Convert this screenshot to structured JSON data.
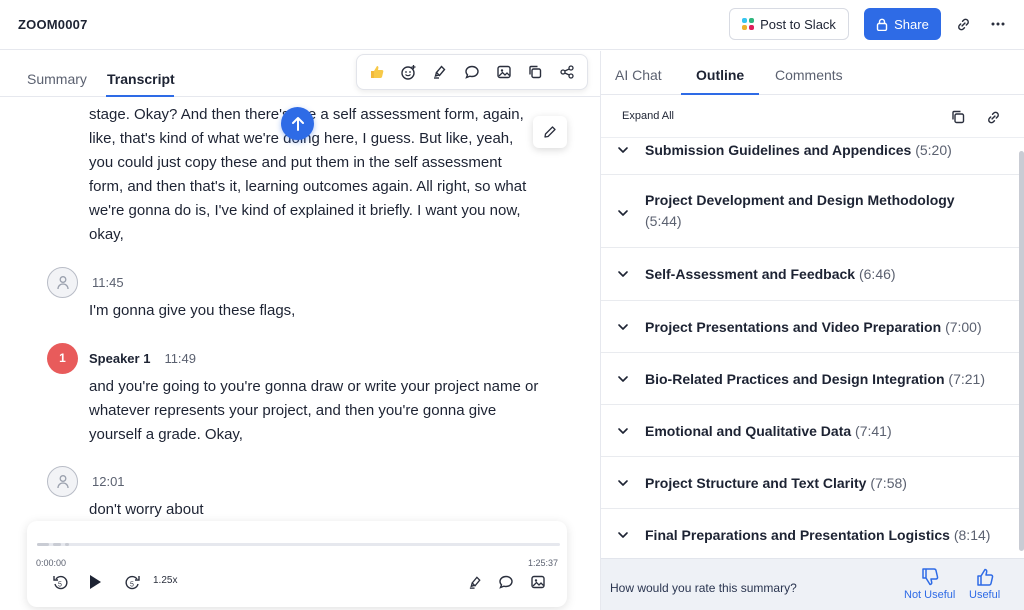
{
  "header": {
    "meeting_title": "ZOOM0007",
    "slack_button": "Post to Slack",
    "share_button": "Share",
    "colors": {
      "accent": "#2e6be6"
    }
  },
  "left_tabs": [
    {
      "label": "Summary"
    },
    {
      "label": "Transcript"
    }
  ],
  "toolbar": {
    "icons": [
      "thumbs-up-icon",
      "add-emoji-icon",
      "highlighter-icon",
      "comment-icon",
      "image-icon",
      "copy-icon",
      "share-icon"
    ]
  },
  "transcript": {
    "intro_paragraph": "stage. Okay? And then there's like a self assessment form, again, like, that's kind of what we're doing here, I guess. But like, yeah, you could just copy these and put them in the self assessment form, and then that's it, learning outcomes again. All right, so what we're gonna do is, I've kind of explained it briefly. I want you now, okay,",
    "entries": [
      {
        "speaker": "",
        "avatar": "",
        "time": "11:45",
        "text": "I'm gonna give you these flags,"
      },
      {
        "speaker": "Speaker 1",
        "avatar": "1",
        "time": "11:49",
        "text": "and you're going to you're gonna draw or write your project name or whatever represents your project, and then you're gonna give yourself a grade. Okay,"
      },
      {
        "speaker": "",
        "avatar": "",
        "time": "12:01",
        "text": "don't worry about"
      }
    ]
  },
  "player": {
    "current_time": "0:00:00",
    "total_time": "1:25:37",
    "speed": "1.25x"
  },
  "right_tabs": [
    {
      "label": "AI Chat"
    },
    {
      "label": "Outline"
    },
    {
      "label": "Comments"
    }
  ],
  "outline": {
    "expand_all": "Expand All",
    "items": [
      {
        "title": "Submission Guidelines and Appendices",
        "time": "(5:20)"
      },
      {
        "title": "Project Development and Design Methodology",
        "time": "(5:44)"
      },
      {
        "title": "Self-Assessment and Feedback",
        "time": "(6:46)"
      },
      {
        "title": "Project Presentations and Video Preparation",
        "time": "(7:00)"
      },
      {
        "title": "Bio-Related Practices and Design Integration",
        "time": "(7:21)"
      },
      {
        "title": "Emotional and Qualitative Data",
        "time": "(7:41)"
      },
      {
        "title": "Project Structure and Text Clarity",
        "time": "(7:58)"
      },
      {
        "title": "Final Preparations and Presentation Logistics",
        "time": "(8:14)"
      }
    ]
  },
  "rating": {
    "question": "How would you rate this summary?",
    "not_useful": "Not Useful",
    "useful": "Useful"
  }
}
